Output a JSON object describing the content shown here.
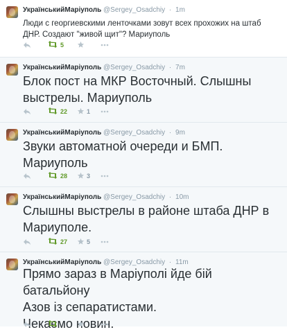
{
  "tweets": [
    {
      "name": "УкраїнськийМаріуполь",
      "handle": "@Sergey_Osadchiy",
      "time": "1m",
      "text": "Люди с георгиевскими ленточками зовут всех прохожих на штаб\nДНР. Создают \"живой щит\"? Мариуполь",
      "retweets": "5",
      "favorites": ""
    },
    {
      "name": "УкраїнськийМаріуполь",
      "handle": "@Sergey_Osadchiy",
      "time": "7m",
      "text": "Блок пост на МКР Восточный. Слышны\nвыстрелы. Мариуполь",
      "retweets": "22",
      "favorites": "1"
    },
    {
      "name": "УкраїнськийМаріуполь",
      "handle": "@Sergey_Osadchiy",
      "time": "9m",
      "text": "Звуки автоматной очереди и БМП.\nМариуполь",
      "retweets": "28",
      "favorites": "3"
    },
    {
      "name": "УкраїнськийМаріуполь",
      "handle": "@Sergey_Osadchiy",
      "time": "10m",
      "text": "Слышны выстрелы в районе штаба ДНР в\nМариуполе.",
      "retweets": "27",
      "favorites": "5"
    },
    {
      "name": "УкраїнськийМаріуполь",
      "handle": "@Sergey_Osadchiy",
      "time": "11m",
      "text": "Прямо зараз в Маріуполі йде бій батальйону\nАзов із сепаратистами.\nЧекаємо новин.",
      "retweets": "",
      "favorites": ""
    }
  ],
  "separator": "·",
  "colors": {
    "retweet": "#609928",
    "muted": "#8899a6",
    "text": "#292f33",
    "stripe": "#f5f8fa"
  },
  "icons": [
    "reply-icon",
    "retweet-icon",
    "favorite-icon",
    "more-icon"
  ]
}
